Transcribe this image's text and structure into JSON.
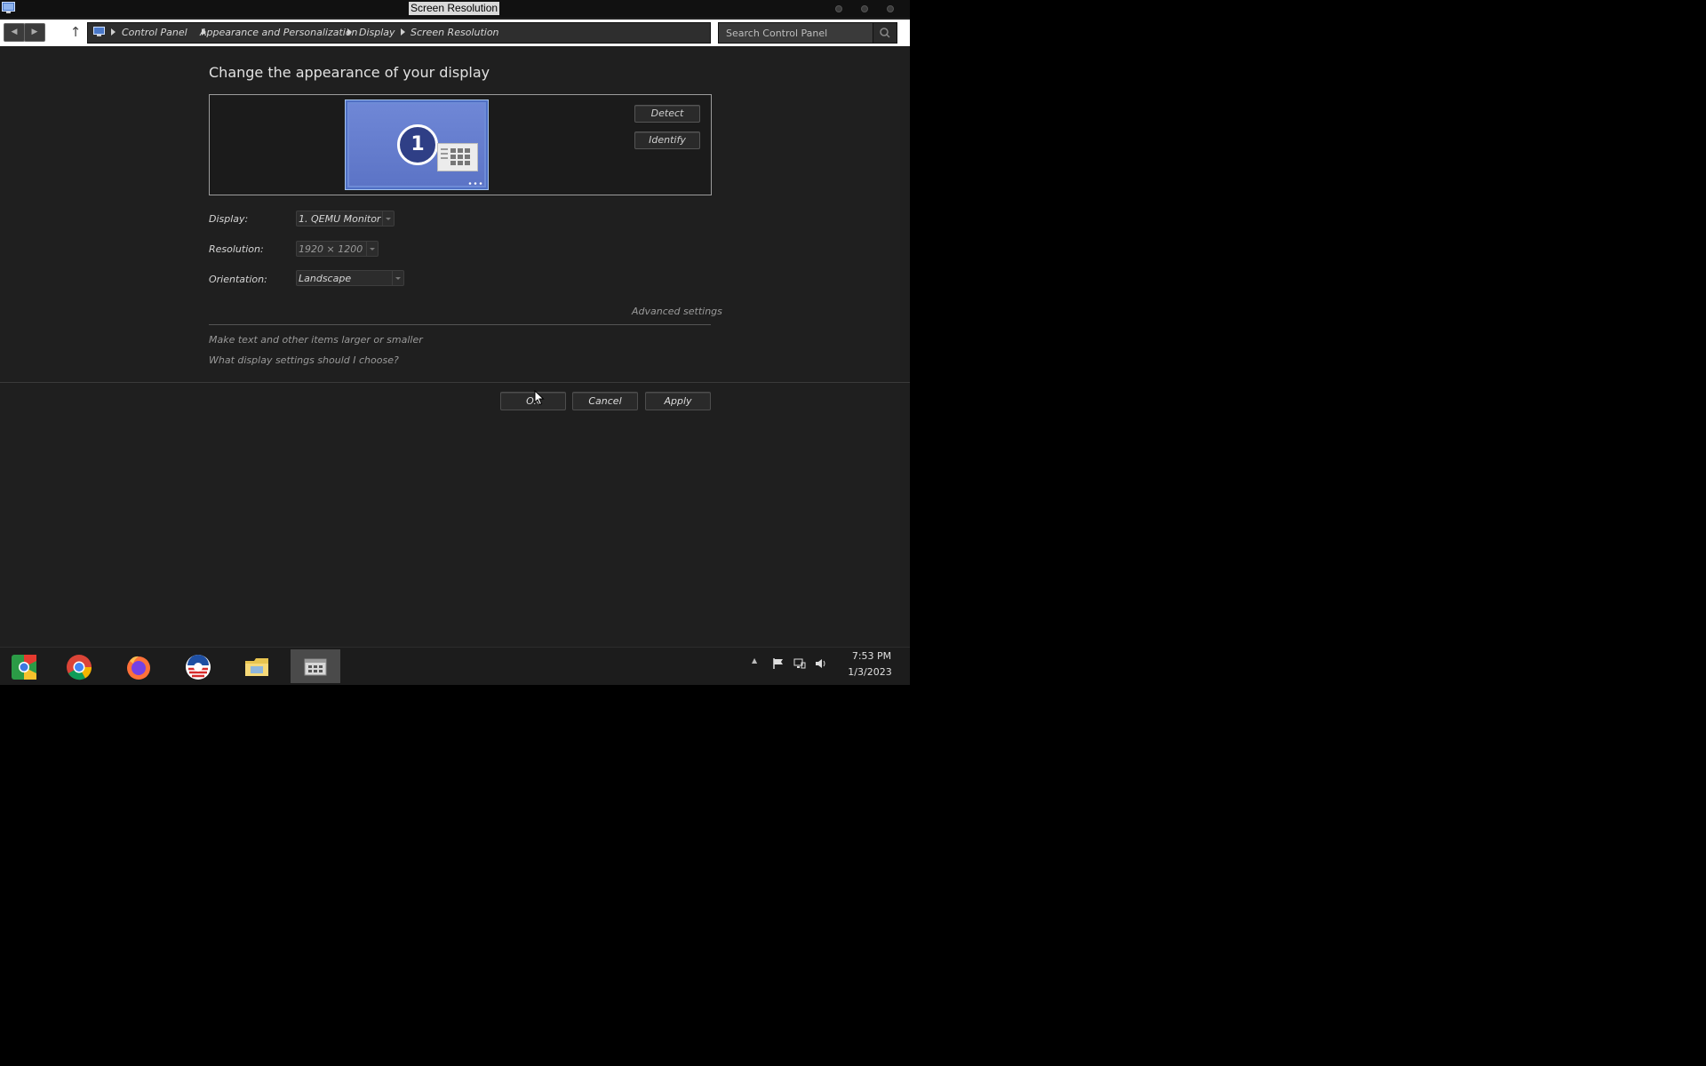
{
  "window": {
    "title": "Screen Resolution"
  },
  "breadcrumb": [
    "Control Panel",
    "Appearance and Personalization",
    "Display",
    "Screen Resolution"
  ],
  "search": {
    "placeholder": "Search Control Panel"
  },
  "main": {
    "heading": "Change the appearance of your display",
    "monitor_number": "1",
    "detect_label": "Detect",
    "identify_label": "Identify",
    "display_label": "Display:",
    "display_value": "1. QEMU Monitor",
    "resolution_label": "Resolution:",
    "resolution_value": "1920 × 1200",
    "orientation_label": "Orientation:",
    "orientation_value": "Landscape",
    "advanced_settings": "Advanced settings",
    "link_text_size": "Make text and other items larger or smaller",
    "link_help": "What display settings should I choose?"
  },
  "buttons": {
    "ok": "OK",
    "cancel": "Cancel",
    "apply": "Apply"
  },
  "taskbar": {
    "apps": [
      "chrome-canary-icon",
      "chrome-icon",
      "firefox-icon",
      "obama-logo-icon",
      "file-explorer-icon",
      "control-panel-icon"
    ],
    "clock_time": "7:53 PM",
    "clock_date": "1/3/2023"
  },
  "colors": {
    "window_bg": "#1f1f1f",
    "taskbar_bg": "#1c1c1c",
    "monitor_blue": "#6e8bd6"
  }
}
